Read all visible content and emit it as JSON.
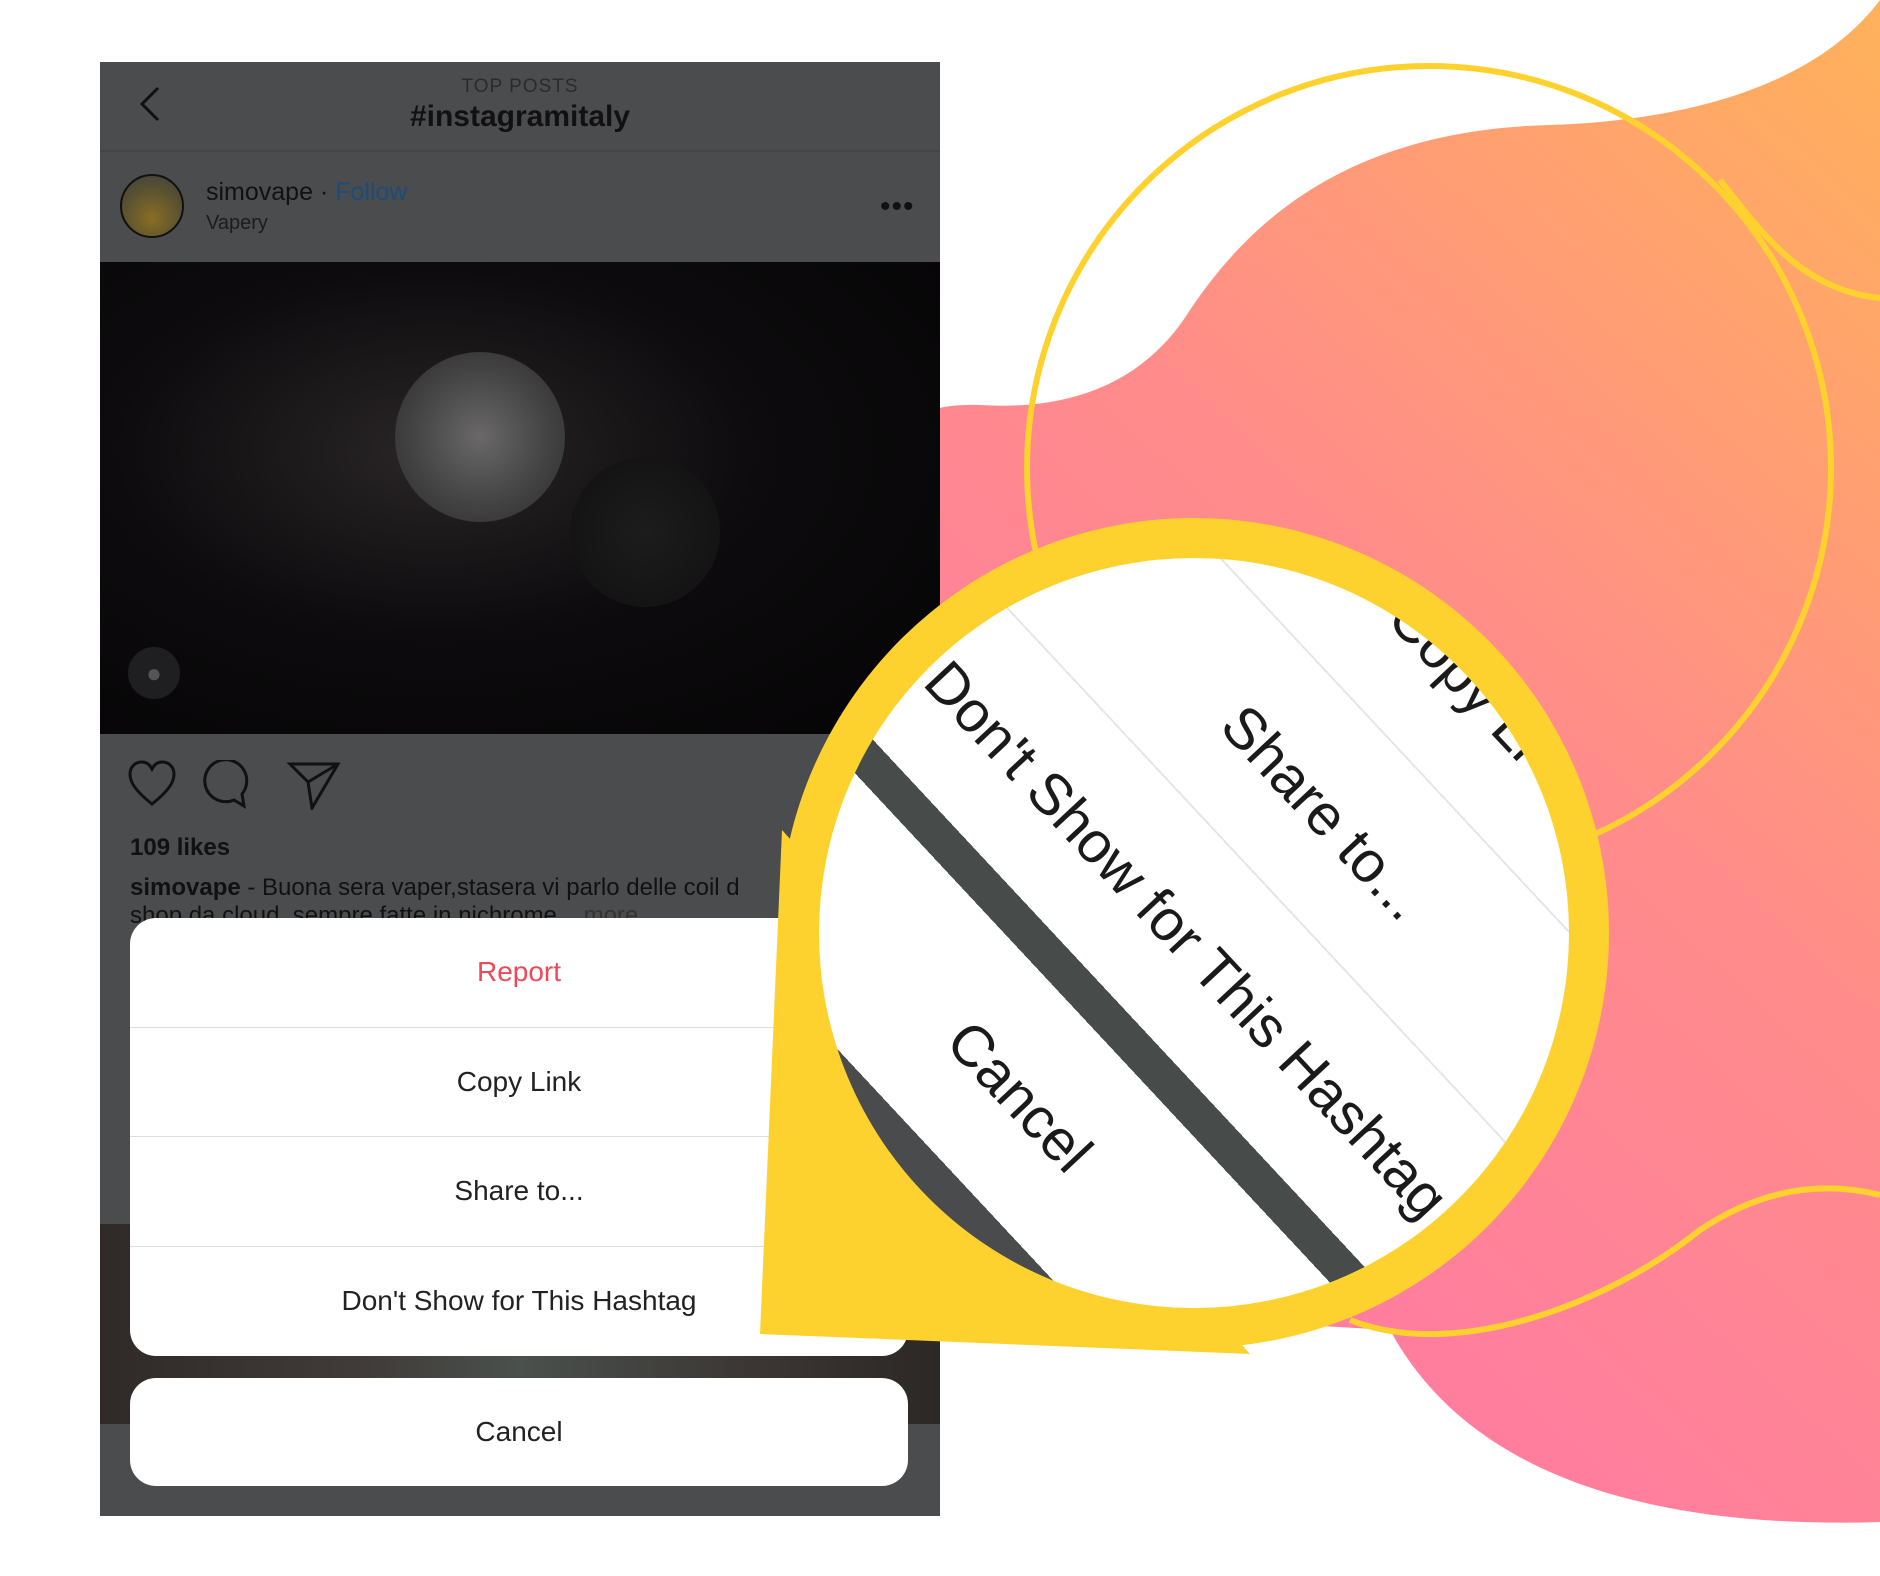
{
  "colors": {
    "accent_yellow": "#FDD22F",
    "blob_top": "#FFB25A",
    "blob_bottom": "#FF78A6",
    "report_red": "#ED4956",
    "follow_blue": "#1A4D7A"
  },
  "header": {
    "subtitle": "TOP POSTS",
    "title": "#instagramitaly",
    "back_icon": "chevron-left-icon"
  },
  "post": {
    "username": "simovape",
    "separator": "·",
    "follow": "Follow",
    "category": "Vapery",
    "more_icon": "ellipsis-icon",
    "likes": "109 likes",
    "caption_user": "simovape",
    "caption_text": " - Buona sera vaper,stasera vi parlo delle coil d",
    "caption_line2": "shop da cloud, sempre fatte in nichrome...",
    "more": "more"
  },
  "action_sheet": {
    "items": [
      {
        "label": "Report"
      },
      {
        "label": "Copy Link"
      },
      {
        "label": "Share to..."
      },
      {
        "label": "Don't Show for This Hashtag"
      }
    ],
    "cancel": "Cancel"
  },
  "magnifier": {
    "items": [
      {
        "label": "Copy Li"
      },
      {
        "label": "Share to..."
      },
      {
        "label": "Don't Show for This Hashtag"
      }
    ],
    "cancel": "Cancel"
  }
}
